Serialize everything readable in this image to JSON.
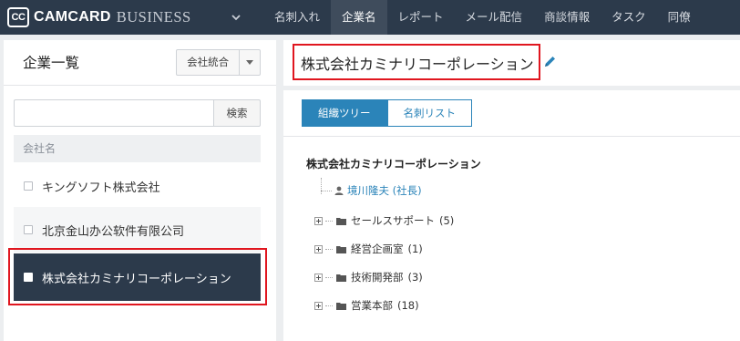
{
  "app": {
    "logo_short": "CC",
    "logo_name": "CAMCARD",
    "logo_sub": "BUSINESS"
  },
  "nav": {
    "items": [
      {
        "label": "名刺入れ",
        "active": false
      },
      {
        "label": "企業名",
        "active": true
      },
      {
        "label": "レポート",
        "active": false
      },
      {
        "label": "メール配信",
        "active": false
      },
      {
        "label": "商談情報",
        "active": false
      },
      {
        "label": "タスク",
        "active": false
      },
      {
        "label": "同僚",
        "active": false
      }
    ]
  },
  "left_panel": {
    "title": "企業一覧",
    "merge_button": "会社統合",
    "search": {
      "value": "",
      "placeholder": "",
      "button": "検索"
    },
    "column_header": "会社名",
    "companies": [
      {
        "name": "キングソフト株式会社",
        "selected": false
      },
      {
        "name": "北京金山办公软件有限公司",
        "selected": false
      },
      {
        "name": "株式会社カミナリコーポレーション",
        "selected": true
      }
    ]
  },
  "detail": {
    "company_name": "株式会社カミナリコーポレーション",
    "tabs": [
      {
        "label": "組織ツリー",
        "active": true
      },
      {
        "label": "名刺リスト",
        "active": false
      }
    ],
    "tree": {
      "root": "株式会社カミナリコーポレーション",
      "person": "境川隆夫 (社長)",
      "departments": [
        {
          "name": "セールスサポート",
          "count": "(5)"
        },
        {
          "name": "経営企画室",
          "count": "(1)"
        },
        {
          "name": "技術開発部",
          "count": "(3)"
        },
        {
          "name": "営業本部",
          "count": "(18)"
        }
      ]
    }
  },
  "colors": {
    "topbar": "#2c3a4b",
    "accent": "#2b84b9",
    "highlight": "#e0161f"
  }
}
